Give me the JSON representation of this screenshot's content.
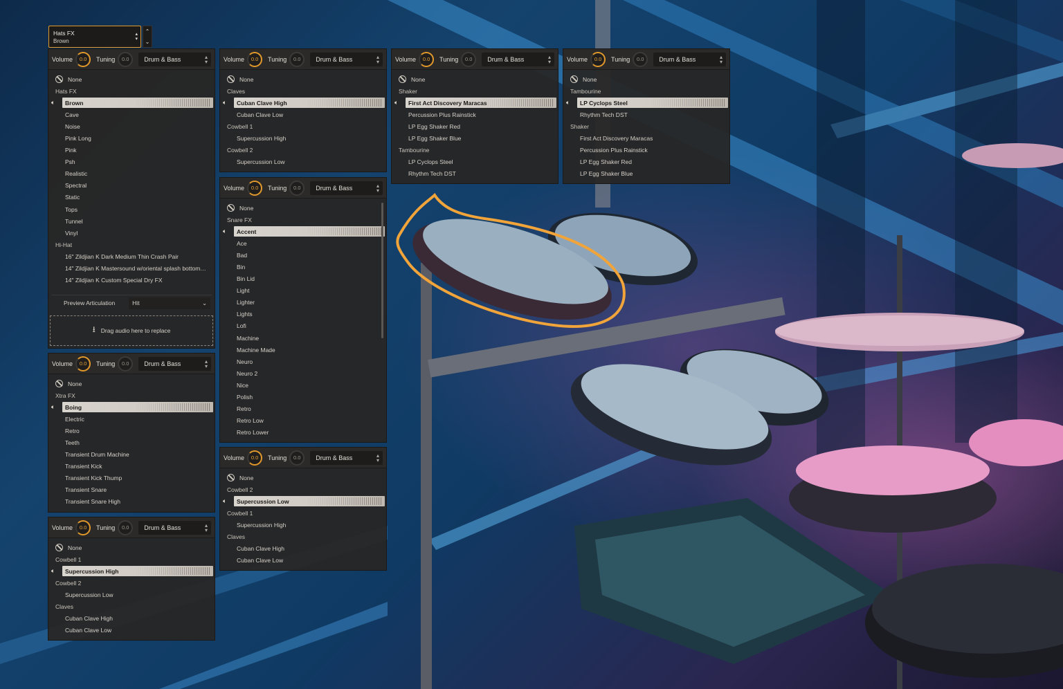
{
  "instrument_selector": {
    "title": "Hats FX",
    "subtitle": "Brown"
  },
  "common": {
    "volume_label": "Volume",
    "tuning_label": "Tuning",
    "volume_value": "0.0",
    "tuning_value": "0.0",
    "kit": "Drum & Bass"
  },
  "panels": [
    {
      "rows": [
        {
          "type": "none",
          "label": "None"
        },
        {
          "type": "cat",
          "label": "Hats FX"
        },
        {
          "type": "sel",
          "label": "Brown"
        },
        {
          "type": "item",
          "label": "Cave"
        },
        {
          "type": "item",
          "label": "Noise"
        },
        {
          "type": "item",
          "label": "Pink Long"
        },
        {
          "type": "item",
          "label": "Pink"
        },
        {
          "type": "item",
          "label": "Psh"
        },
        {
          "type": "item",
          "label": "Realistic"
        },
        {
          "type": "item",
          "label": "Spectral"
        },
        {
          "type": "item",
          "label": "Static"
        },
        {
          "type": "item",
          "label": "Tops"
        },
        {
          "type": "item",
          "label": "Tunnel"
        },
        {
          "type": "item",
          "label": "Vinyl"
        },
        {
          "type": "cat",
          "label": "Hi-Hat"
        },
        {
          "type": "item",
          "label": "16\" Zildjian K Dark Medium Thin Crash Pair"
        },
        {
          "type": "item",
          "label": "14\" Zildjian K Mastersound w/oriental splash bottom…"
        },
        {
          "type": "item",
          "label": "14\" Zildjian K Custom Special Dry FX"
        }
      ],
      "preview": {
        "label": "Preview Articulation",
        "value": "Hit"
      },
      "drop_label": "Drag audio here to replace"
    },
    {
      "rows": [
        {
          "type": "none",
          "label": "None"
        },
        {
          "type": "cat",
          "label": "Xtra FX"
        },
        {
          "type": "sel",
          "label": "Boing"
        },
        {
          "type": "item",
          "label": "Electric"
        },
        {
          "type": "item",
          "label": "Retro"
        },
        {
          "type": "item",
          "label": "Teeth"
        },
        {
          "type": "item",
          "label": "Transient Drum Machine"
        },
        {
          "type": "item",
          "label": "Transient Kick"
        },
        {
          "type": "item",
          "label": "Transient Kick Thump"
        },
        {
          "type": "item",
          "label": "Transient Snare"
        },
        {
          "type": "item",
          "label": "Transient Snare High"
        }
      ]
    },
    {
      "rows": [
        {
          "type": "none",
          "label": "None"
        },
        {
          "type": "cat",
          "label": "Cowbell 1"
        },
        {
          "type": "sel",
          "label": "Supercussion High"
        },
        {
          "type": "cat",
          "label": "Cowbell 2"
        },
        {
          "type": "item",
          "label": "Supercussion Low"
        },
        {
          "type": "cat",
          "label": "Claves"
        },
        {
          "type": "item",
          "label": "Cuban Clave High"
        },
        {
          "type": "item",
          "label": "Cuban Clave Low"
        }
      ]
    },
    {
      "rows": [
        {
          "type": "none",
          "label": "None"
        },
        {
          "type": "cat",
          "label": "Claves"
        },
        {
          "type": "sel",
          "label": "Cuban Clave High"
        },
        {
          "type": "item",
          "label": "Cuban Clave Low"
        },
        {
          "type": "cat",
          "label": "Cowbell 1"
        },
        {
          "type": "item",
          "label": "Supercussion High"
        },
        {
          "type": "cat",
          "label": "Cowbell 2"
        },
        {
          "type": "item",
          "label": "Supercussion Low"
        }
      ]
    },
    {
      "rows": [
        {
          "type": "none",
          "label": "None"
        },
        {
          "type": "cat",
          "label": "Snare FX"
        },
        {
          "type": "sel",
          "label": "Accent"
        },
        {
          "type": "item",
          "label": "Ace"
        },
        {
          "type": "item",
          "label": "Bad"
        },
        {
          "type": "item",
          "label": "Bin"
        },
        {
          "type": "item",
          "label": "Bin Lid"
        },
        {
          "type": "item",
          "label": "Light"
        },
        {
          "type": "item",
          "label": "Lighter"
        },
        {
          "type": "item",
          "label": "Lights"
        },
        {
          "type": "item",
          "label": "Lofi"
        },
        {
          "type": "item",
          "label": "Machine"
        },
        {
          "type": "item",
          "label": "Machine Made"
        },
        {
          "type": "item",
          "label": "Neuro"
        },
        {
          "type": "item",
          "label": "Neuro 2"
        },
        {
          "type": "item",
          "label": "Nice"
        },
        {
          "type": "item",
          "label": "Polish"
        },
        {
          "type": "item",
          "label": "Retro"
        },
        {
          "type": "item",
          "label": "Retro Low"
        },
        {
          "type": "item",
          "label": "Retro Lower"
        }
      ]
    },
    {
      "rows": [
        {
          "type": "none",
          "label": "None"
        },
        {
          "type": "cat",
          "label": "Cowbell 2"
        },
        {
          "type": "sel",
          "label": "Supercussion Low"
        },
        {
          "type": "cat",
          "label": "Cowbell 1"
        },
        {
          "type": "item",
          "label": "Supercussion High"
        },
        {
          "type": "cat",
          "label": "Claves"
        },
        {
          "type": "item",
          "label": "Cuban Clave High"
        },
        {
          "type": "item",
          "label": "Cuban Clave Low"
        }
      ]
    },
    {
      "rows": [
        {
          "type": "none",
          "label": "None"
        },
        {
          "type": "cat",
          "label": "Shaker"
        },
        {
          "type": "sel",
          "label": "First Act Discovery Maracas"
        },
        {
          "type": "item",
          "label": "Percussion Plus Rainstick"
        },
        {
          "type": "item",
          "label": "LP Egg Shaker Red"
        },
        {
          "type": "item",
          "label": "LP Egg Shaker Blue"
        },
        {
          "type": "cat",
          "label": "Tambourine"
        },
        {
          "type": "item",
          "label": "LP Cyclops Steel"
        },
        {
          "type": "item",
          "label": "Rhythm Tech DST"
        }
      ]
    },
    {
      "rows": [
        {
          "type": "none",
          "label": "None"
        },
        {
          "type": "cat",
          "label": "Tambourine"
        },
        {
          "type": "sel",
          "label": "LP Cyclops Steel"
        },
        {
          "type": "item",
          "label": "Rhythm Tech DST"
        },
        {
          "type": "cat",
          "label": "Shaker"
        },
        {
          "type": "item",
          "label": "First Act Discovery Maracas"
        },
        {
          "type": "item",
          "label": "Percussion Plus Rainstick"
        },
        {
          "type": "item",
          "label": "LP Egg Shaker Red"
        },
        {
          "type": "item",
          "label": "LP Egg Shaker Blue"
        }
      ]
    }
  ],
  "colors": {
    "accent": "#e39a2c",
    "panel": "#2a2826",
    "highlight": "#d8d4ce"
  },
  "icons": {
    "none": "no-symbol-icon",
    "speaker": "speaker-icon",
    "download": "download-icon"
  }
}
